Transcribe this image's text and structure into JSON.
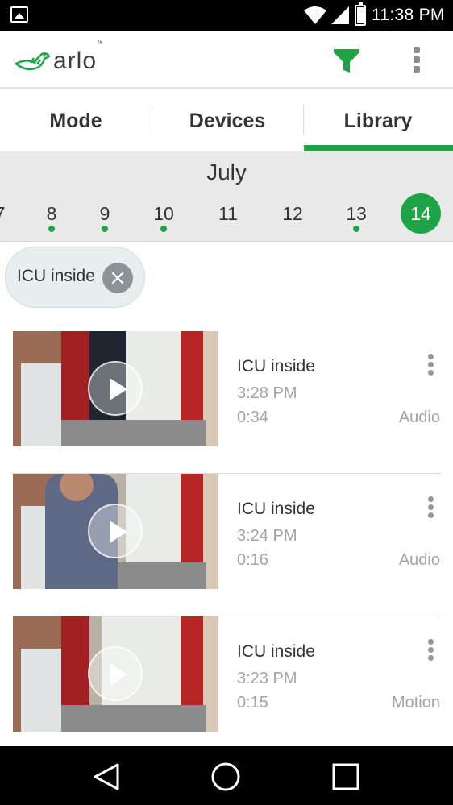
{
  "status_bar": {
    "time": "11:38 PM",
    "icons": [
      "gallery-notification-icon",
      "wifi-icon",
      "cell-signal-icon",
      "battery-charging-icon"
    ]
  },
  "app_bar": {
    "logo_text": "arlo",
    "logo_tm": "™",
    "icons": [
      "arlo-bird-logo",
      "filter-icon",
      "more-vert-icon"
    ],
    "accent_color": "#1ea446"
  },
  "tabs": [
    {
      "label": "Mode",
      "selected": false
    },
    {
      "label": "Devices",
      "selected": false
    },
    {
      "label": "Library",
      "selected": true
    }
  ],
  "calendar": {
    "month": "July",
    "days": [
      {
        "label": "7",
        "has_recordings": false,
        "selected": false
      },
      {
        "label": "8",
        "has_recordings": true,
        "selected": false
      },
      {
        "label": "9",
        "has_recordings": true,
        "selected": false
      },
      {
        "label": "10",
        "has_recordings": true,
        "selected": false
      },
      {
        "label": "11",
        "has_recordings": false,
        "selected": false
      },
      {
        "label": "12",
        "has_recordings": false,
        "selected": false
      },
      {
        "label": "13",
        "has_recordings": true,
        "selected": false
      },
      {
        "label": "14",
        "has_recordings": false,
        "selected": true
      }
    ]
  },
  "filter_chip": {
    "label": "ICU inside",
    "icon": "close-icon"
  },
  "recordings": [
    {
      "camera": "ICU inside",
      "time": "3:28 PM",
      "duration": "0:34",
      "trigger": "Audio",
      "thumbnail": "doorway-empty"
    },
    {
      "camera": "ICU inside",
      "time": "3:24 PM",
      "duration": "0:16",
      "trigger": "Audio",
      "thumbnail": "doorway-person"
    },
    {
      "camera": "ICU inside",
      "time": "3:23 PM",
      "duration": "0:15",
      "trigger": "Motion",
      "thumbnail": "doorway-closed"
    }
  ],
  "nav_bar": {
    "icons": [
      "back-icon",
      "home-icon",
      "recents-icon"
    ]
  }
}
